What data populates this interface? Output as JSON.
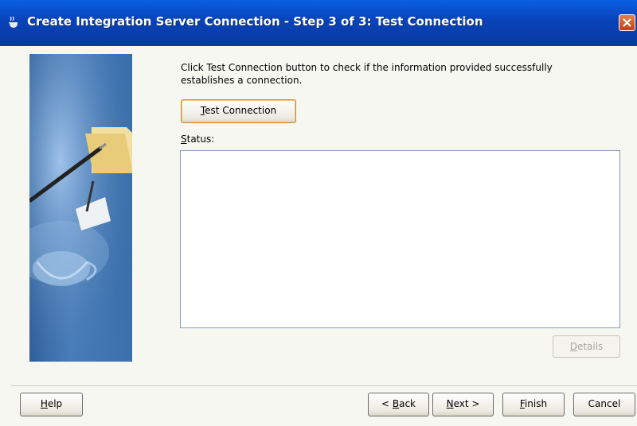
{
  "window": {
    "title": "Create Integration Server Connection - Step 3 of 3: Test Connection"
  },
  "content": {
    "instruction": "Click Test Connection button to check if the information provided successfully establishes a connection.",
    "test_button": {
      "mnemonic": "T",
      "rest": "est Connection"
    },
    "status_label": {
      "mnemonic": "S",
      "rest": "tatus:"
    },
    "status_text": "",
    "details_button": {
      "mnemonic": "D",
      "rest": "etails"
    }
  },
  "footer": {
    "help": {
      "mnemonic": "H",
      "rest": "elp"
    },
    "back": {
      "prefix": "< ",
      "mnemonic": "B",
      "rest": "ack"
    },
    "next": {
      "mnemonic": "N",
      "rest": "ext >"
    },
    "finish": {
      "mnemonic": "F",
      "rest": "inish"
    },
    "cancel": "Cancel"
  },
  "colors": {
    "titlebar": "#0842b8",
    "dialog_bg": "#f7f7f2",
    "focus_border": "#c28a3a"
  }
}
